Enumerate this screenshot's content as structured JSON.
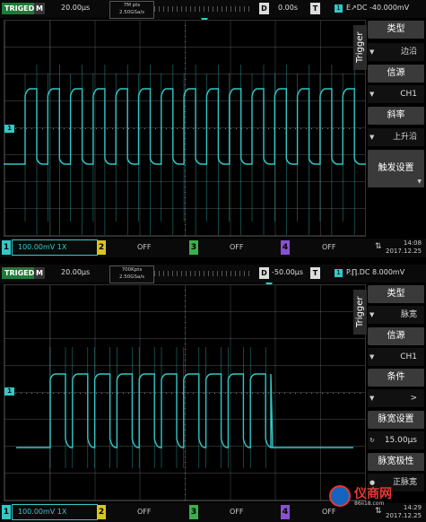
{
  "screens": [
    {
      "trig_status": "TRIGED",
      "mode": "M",
      "timebase": "20.00μs",
      "memory": [
        "7M pts",
        "2.50GSa/s"
      ],
      "delay_label": "D",
      "delay": "0.00s",
      "trig_label": "T",
      "trig_source_badge": "1",
      "trig_info": "E↗DC -40.000mV",
      "menu": {
        "tab": "Trigger",
        "items": [
          {
            "title": "类型",
            "value": "边沿"
          },
          {
            "title": "信源",
            "value": "CH1"
          },
          {
            "title": "斜率",
            "value": "上升沿"
          }
        ],
        "button": "触发设置"
      },
      "bottom": {
        "ch1_num": "1",
        "ch1": "100.00mV 1X",
        "ch2_num": "2",
        "ch2": "OFF",
        "ch3_num": "3",
        "ch3": "OFF",
        "ch4_num": "4",
        "ch4": "OFF",
        "time": "14:08",
        "date": "2017.12.25"
      }
    },
    {
      "trig_status": "TRIGED",
      "mode": "M",
      "timebase": "20.00μs",
      "memory": [
        "700Kpts",
        "2.50GSa/s"
      ],
      "delay_label": "D",
      "delay": "-50.00μs",
      "trig_label": "T",
      "trig_source_badge": "1",
      "trig_info": "P.∏.DC 8.000mV",
      "menu": {
        "tab": "Trigger",
        "items": [
          {
            "title": "类型",
            "value": "脉宽"
          },
          {
            "title": "信源",
            "value": "CH1"
          },
          {
            "title": "条件",
            "value": ">"
          },
          {
            "title": "脉宽设置",
            "value": "15.00μs"
          }
        ],
        "button": "脉宽极性",
        "button_value": "正脉宽"
      },
      "bottom": {
        "ch1_num": "1",
        "ch1": "100.00mV 1X",
        "ch2_num": "2",
        "ch2": "OFF",
        "ch3_num": "3",
        "ch3": "OFF",
        "ch4_num": "4",
        "ch4": "OFF",
        "time": "14:29",
        "date": "2017.12.25"
      }
    }
  ],
  "watermark": {
    "text": "仪商网",
    "url": "86ii18.com"
  },
  "colors": {
    "trace": "#33c8c8",
    "ch2": "#d9c520",
    "ch3": "#3bb04a",
    "ch4": "#8a4fd1",
    "triged": "#1f7a3a"
  },
  "icons": [
    "usb-icon",
    "arrow-down-icon",
    "knob-icon",
    "trigger-position-icon"
  ]
}
